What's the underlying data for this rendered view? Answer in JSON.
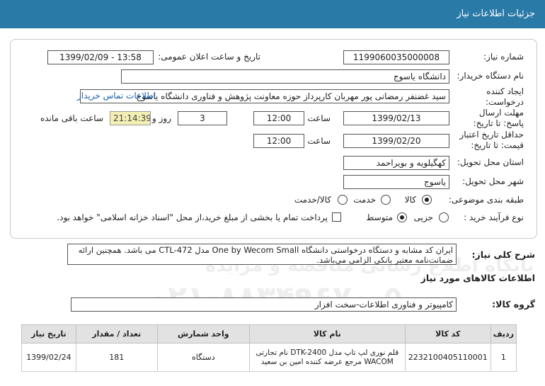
{
  "header": {
    "title": "جزئیات اطلاعات نیاز"
  },
  "fields": {
    "need_number_label": "شماره نیاز:",
    "need_number": "1199060035000008",
    "announce_label": "تاریخ و ساعت اعلان عمومی:",
    "announce_value": "1399/02/09 - 13:58",
    "buyer_label": "نام دستگاه خریدار:",
    "buyer_value": "دانشگاه یاسوج",
    "creator_label": "ایجاد کننده درخواست:",
    "creator_value": "سید غضنفر رمضانی پور مهربان کارپرداز حوزه معاونت پژوهش و فناوری دانشگاه یاسوج",
    "contact_link": "اطلاعات تماس خریدار",
    "deadline_label": "مهلت ارسال پاسخ: تا تاریخ:",
    "deadline_date": "1399/02/13",
    "time_label": "ساعت",
    "deadline_time": "12:00",
    "days": "3",
    "days_label": "روز و",
    "remaining_time": "21:14:39",
    "remaining_label": "ساعت باقی مانده",
    "validity_label": "حداقل تاریخ اعتبار قیمت: تا تاریخ:",
    "validity_date": "1399/02/20",
    "validity_time": "12:00",
    "province_label": "استان محل تحویل:",
    "province_value": "کهگیلویه و بویراحمد",
    "city_label": "شهر محل تحویل:",
    "city_value": "یاسوج",
    "category_label": "طبقه بندی موضوعی:",
    "category_options": [
      "کالا",
      "خدمت",
      "کالا/خدمت"
    ],
    "process_label": "نوع فرآیند خرید :",
    "process_options": [
      "جزیی",
      "متوسط"
    ],
    "payment_note": "پرداخت تمام یا بخشی از مبلغ خرید،از محل \"اسناد خزانه اسلامی\" خواهد بود."
  },
  "description": {
    "label": "شرح کلی نیاز:",
    "text": "ایران کد مشابه و دستگاه درخواستی دانشگاه One by Wecom Small مدل CTL-472 می باشد. همچنین ارائه ضمانت‌نامه معتبر بانکی الزامی می‌باشد."
  },
  "goods": {
    "section_label": "اطلاعات کالاهای مورد نیاز",
    "group_label": "گروه کالا:",
    "group_value": "کامپیوتر و فناوری اطلاعات-سخت افزار"
  },
  "table": {
    "headers": [
      "ردیف",
      "کد کالا",
      "نام کالا",
      "واحد شمارش",
      "تعداد / مقدار",
      "تاریخ نیاز"
    ],
    "rows": [
      [
        "1",
        "2232100405110001",
        "قلم نوری لپ تاپ مدل DTK-2400 نام تجارتی WACOM مرجع عرضه کننده امین بن سعید",
        "دستگاه",
        "181",
        "1399/02/24"
      ]
    ]
  },
  "watermark": {
    "line1": "پایگاه اطلاع رسانی مناقصه و مزایده",
    "line2": "۰۲۱-۸۸۳۴۹۶۷۰-۵"
  }
}
